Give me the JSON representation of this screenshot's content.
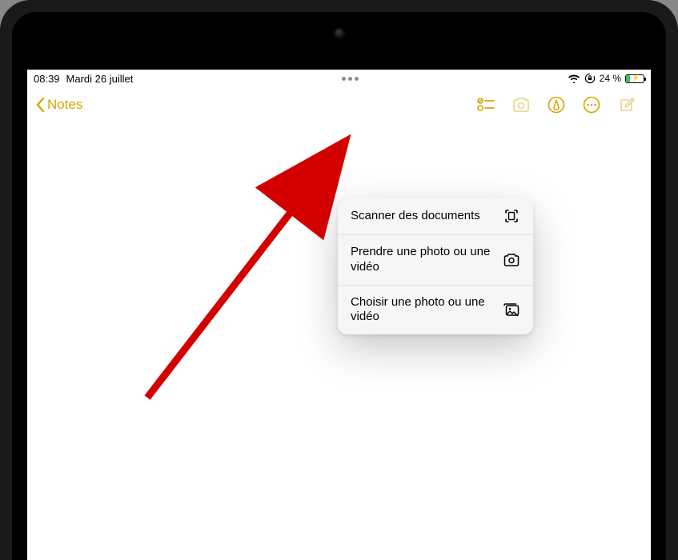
{
  "status": {
    "time": "08:39",
    "date": "Mardi 26 juillet",
    "battery_text": "24 %",
    "battery_pct": 24
  },
  "nav": {
    "back_label": "Notes"
  },
  "popover": {
    "items": [
      {
        "label": "Scanner des documents",
        "icon": "scan-icon"
      },
      {
        "label": "Prendre une photo ou une vidéo",
        "icon": "camera-icon"
      },
      {
        "label": "Choisir une photo ou une vidéo",
        "icon": "gallery-icon"
      }
    ]
  },
  "colors": {
    "accent": "#d8a400",
    "arrow": "#d40000"
  }
}
